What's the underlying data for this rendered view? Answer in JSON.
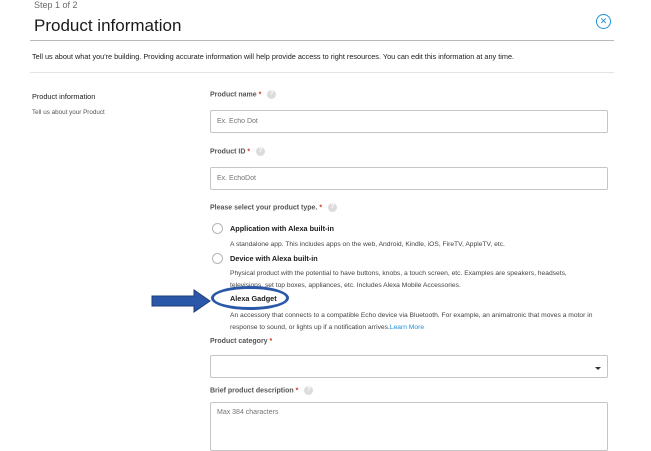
{
  "header": {
    "step": "Step 1 of 2",
    "title": "Product information",
    "close_glyph": "✕",
    "intro": "Tell us about what you're building. Providing accurate information will help provide access to right resources. You can edit this information at any time."
  },
  "section": {
    "title": "Product information",
    "subtitle": "Tell us about your Product"
  },
  "fields": {
    "product_name": {
      "label": "Product name",
      "required": "*",
      "help": "?",
      "placeholder": "Ex. Echo Dot"
    },
    "product_id": {
      "label": "Product ID",
      "required": "*",
      "help": "?",
      "placeholder": "Ex. EchoDot"
    },
    "product_type": {
      "label": "Please select your product type.",
      "required": "*",
      "help": "?",
      "options": [
        {
          "label": "Application with Alexa built-in",
          "description": "A standalone app. This includes apps on the web, Android, Kindle, iOS, FireTV, AppleTV, etc."
        },
        {
          "label": "Device with Alexa built-in",
          "description_line1": "Physical product with the potential to have buttons, knobs, a touch screen, etc. Examples are speakers, headsets,",
          "description_line2": "televisions, set top boxes, appliances, etc. Includes Alexa Mobile Accessories."
        },
        {
          "label": "Alexa Gadget",
          "description_line1": "An accessory that connects to a compatible Echo device via Bluetooth. For example, an animatronic that moves a motor in",
          "description_line2": "response to sound, or lights up if a notification arrives.",
          "link": "Learn More"
        }
      ]
    },
    "product_category": {
      "label": "Product category",
      "required": "*",
      "value": ""
    },
    "brief_description": {
      "label": "Brief product description",
      "required": "*",
      "help": "?",
      "placeholder": "Max 384 characters"
    }
  },
  "annotation": {
    "arrow_color": "#2a57a8",
    "highlight_color": "#2a57a8"
  }
}
